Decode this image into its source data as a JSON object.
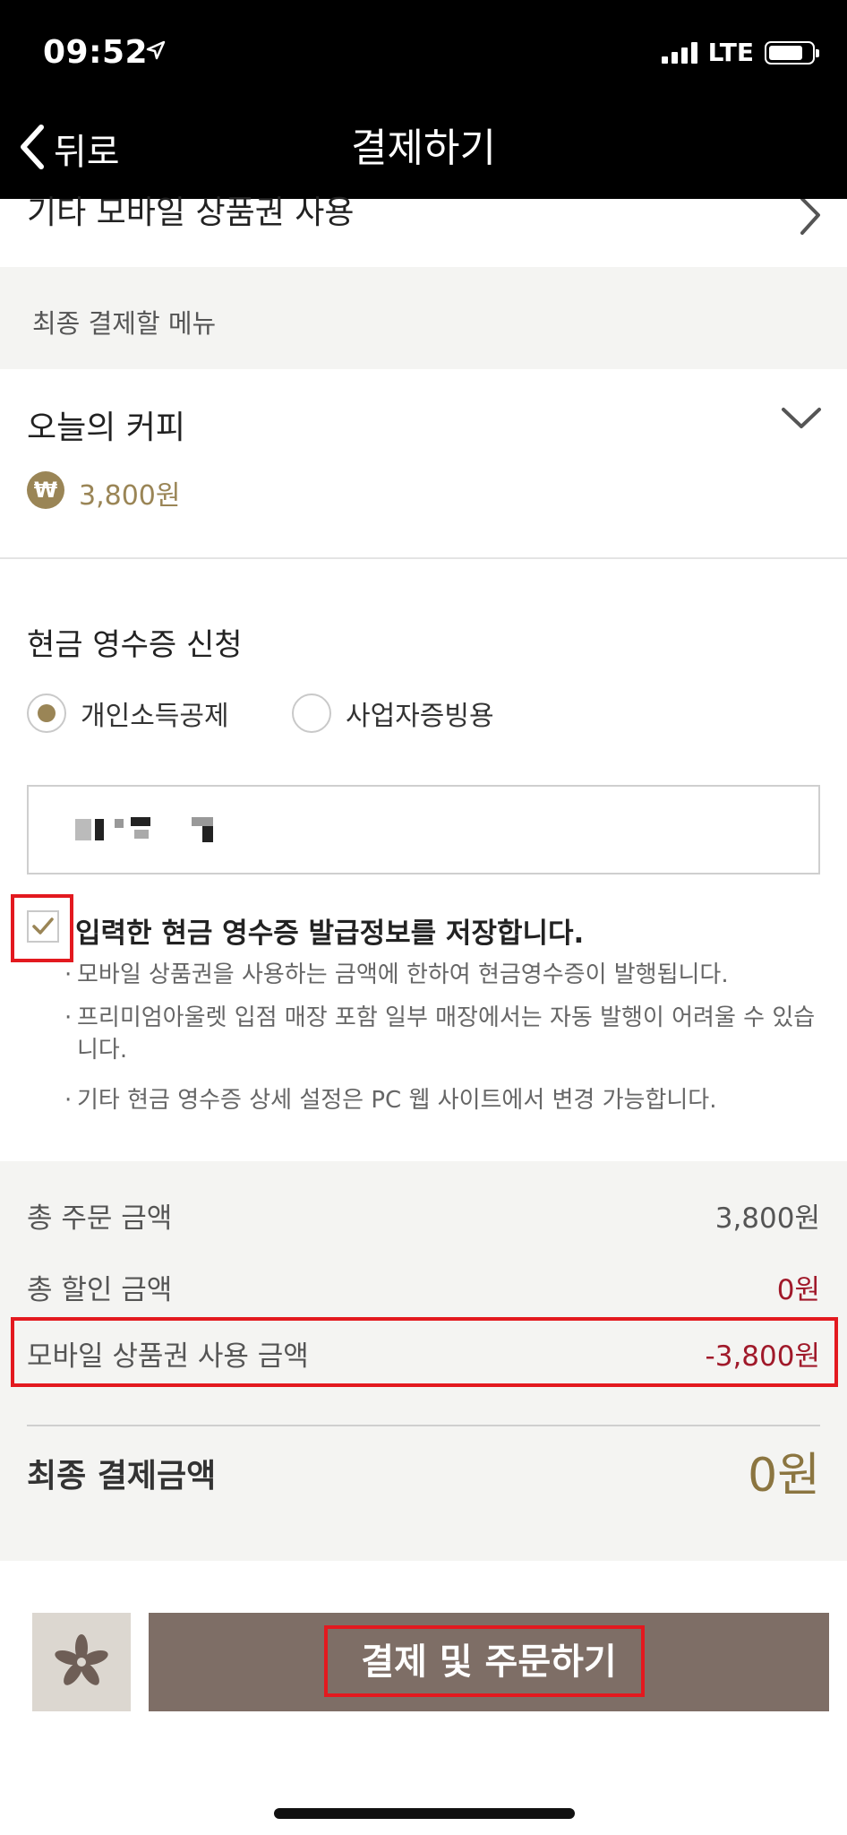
{
  "status_bar": {
    "time": "09:52",
    "network": "LTE"
  },
  "nav": {
    "back_label": "뒤로",
    "title": "결제하기"
  },
  "mobile_voucher_row": {
    "label": "기타 모바일 상품권 사용"
  },
  "final_menu_section": {
    "label": "최종 결제할 메뉴"
  },
  "menu": {
    "name": "오늘의 커피",
    "currency_symbol": "₩",
    "price": "3,800원"
  },
  "cash_receipt": {
    "title": "현금 영수증 신청",
    "options": [
      {
        "label": "개인소득공제",
        "selected": true
      },
      {
        "label": "사업자증빙용",
        "selected": false
      }
    ],
    "input_value": "",
    "save_label": "입력한 현금 영수증 발급정보를 저장합니다.",
    "save_checked": true,
    "notes": [
      "모바일 상품권을 사용하는 금액에 한하여 현금영수증이 발행됩니다.",
      "프리미엄아울렛 입점 매장 포함 일부 매장에서는 자동 발행이 어려울 수 있습니다.",
      "기타 현금 영수증 상세 설정은 PC 웹 사이트에서 변경 가능합니다."
    ]
  },
  "summary": {
    "total_order_label": "총 주문 금액",
    "total_order_value": "3,800원",
    "total_discount_label": "총 할인 금액",
    "total_discount_value": "0원",
    "mobile_voucher_label": "모바일 상품권 사용 금액",
    "mobile_voucher_value": "-3,800원",
    "final_label": "최종 결제금액",
    "final_value": "0원"
  },
  "actions": {
    "pay_button_label": "결제 및 주문하기",
    "icon_button": "flower-icon"
  },
  "colors": {
    "accent_gold": "#9a8556",
    "discount_red": "#a0192a",
    "button_brown": "#7e6e66",
    "annotation_red": "#e3191f"
  }
}
